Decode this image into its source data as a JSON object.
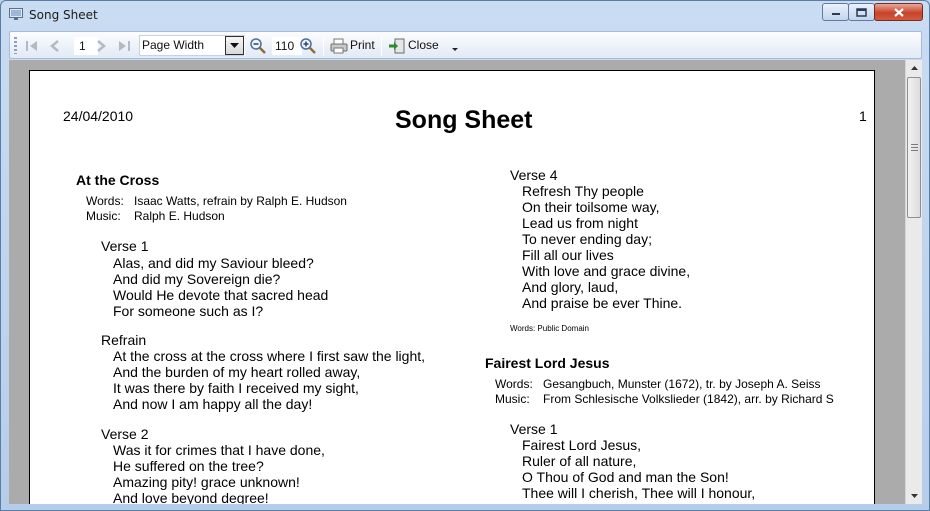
{
  "window": {
    "title": "Song Sheet"
  },
  "toolbar": {
    "page_number": "1",
    "zoom_mode": "Page Width",
    "zoom_value": "110",
    "print_label": "Print",
    "close_label": "Close",
    "icons": [
      "first-page-icon",
      "previous-page-icon",
      "next-page-icon",
      "last-page-icon",
      "zoom-out-icon",
      "zoom-in-icon",
      "printer-icon",
      "exit-icon"
    ]
  },
  "document": {
    "date": "24/04/2010",
    "page_number": "1",
    "title": "Song Sheet",
    "songs": [
      {
        "title": "At the Cross",
        "words_label": "Words:",
        "words": "Isaac Watts, refrain by Ralph E. Hudson",
        "music_label": "Music:",
        "music": "Ralph E. Hudson",
        "sections": [
          {
            "heading": "Verse 1",
            "lines": [
              "Alas, and did my Saviour bleed?",
              "And did my Sovereign die?",
              "Would He devote that sacred head",
              "For someone such as I?"
            ]
          },
          {
            "heading": "Refrain",
            "lines": [
              "At the cross at the cross where I first saw the light,",
              "And the burden of my heart rolled away,",
              "It was there by faith I received my sight,",
              "And now I am happy all the day!"
            ]
          },
          {
            "heading": "Verse 2",
            "lines": [
              "Was it for crimes that I have done,",
              "He suffered on the tree?",
              "Amazing pity! grace unknown!",
              "And love beyond degree!"
            ]
          }
        ]
      },
      {
        "sections": [
          {
            "heading": "Verse 4",
            "lines": [
              "Refresh Thy people",
              "On their toilsome way,",
              "Lead us from night",
              "To never ending day;",
              "Fill all our lives",
              "With love and grace divine,",
              "And glory, laud,",
              "And praise be ever Thine."
            ]
          }
        ],
        "footnote": "Words: Public Domain"
      },
      {
        "title": "Fairest Lord Jesus",
        "words_label": "Words:",
        "words": "Gesangbuch, Munster (1672), tr. by Joseph A. Seiss",
        "music_label": "Music:",
        "music": "From Schlesische Volkslieder (1842), arr. by Richard S",
        "sections": [
          {
            "heading": "Verse 1",
            "lines": [
              "Fairest Lord Jesus,",
              "Ruler of all nature,",
              "O Thou of God and man the Son!",
              "Thee will I cherish, Thee will I honour,"
            ]
          }
        ]
      }
    ]
  }
}
